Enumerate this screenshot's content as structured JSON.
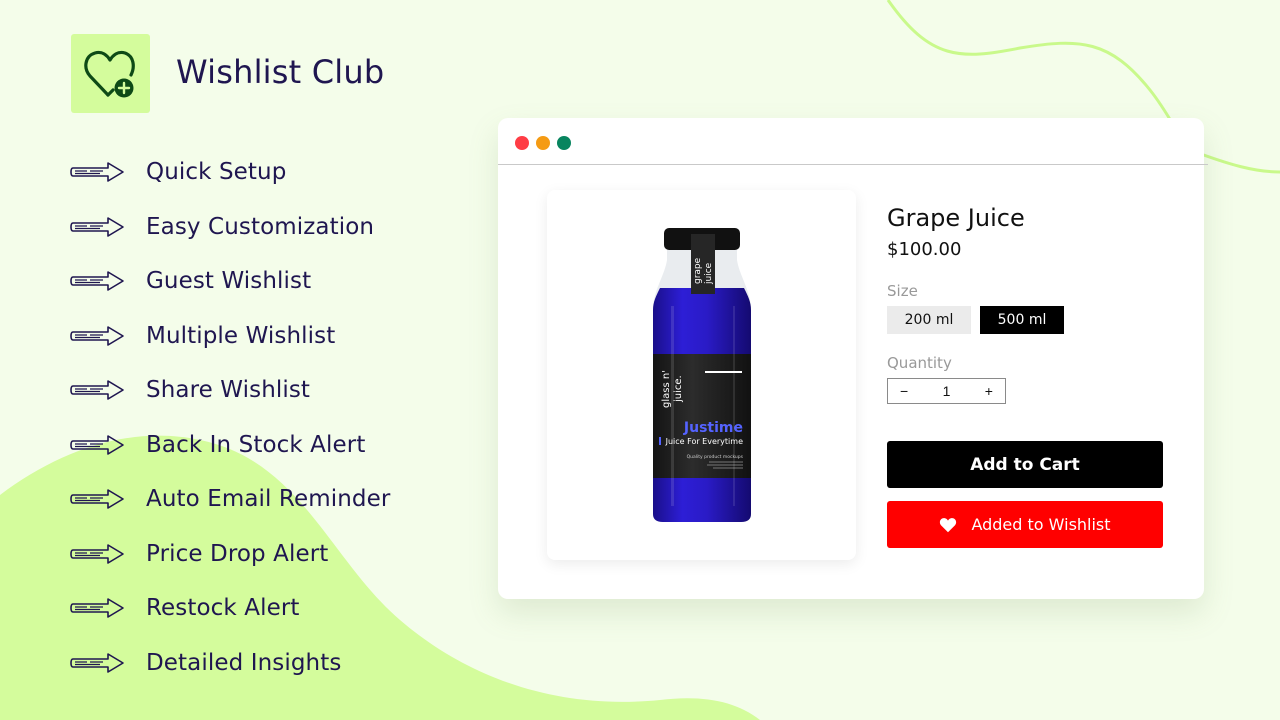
{
  "brand": {
    "name": "Wishlist Club",
    "logo_icon": "heart-plus-icon",
    "accent_color": "#d4fc9c",
    "text_color": "#1f1650"
  },
  "features": [
    {
      "label": "Quick Setup",
      "icon": "arrow-right-icon"
    },
    {
      "label": "Easy Customization",
      "icon": "arrow-right-icon"
    },
    {
      "label": "Guest Wishlist",
      "icon": "arrow-right-icon"
    },
    {
      "label": "Multiple Wishlist",
      "icon": "arrow-right-icon"
    },
    {
      "label": "Share Wishlist",
      "icon": "arrow-right-icon"
    },
    {
      "label": "Back In Stock Alert",
      "icon": "arrow-right-icon"
    },
    {
      "label": "Auto Email Reminder",
      "icon": "arrow-right-icon"
    },
    {
      "label": "Price Drop Alert",
      "icon": "arrow-right-icon"
    },
    {
      "label": "Restock Alert",
      "icon": "arrow-right-icon"
    },
    {
      "label": "Detailed Insights",
      "icon": "arrow-right-icon"
    }
  ],
  "browser": {
    "window_controls": [
      {
        "name": "close",
        "color": "#ff3d45"
      },
      {
        "name": "minimize",
        "color": "#f59b13"
      },
      {
        "name": "maximize",
        "color": "#08855f"
      }
    ]
  },
  "product": {
    "image": {
      "cap_label_line1": "grape",
      "cap_label_line2": "juice",
      "side_label_line1": "glass n'",
      "side_label_line2": "juice.",
      "brand": "Justime",
      "tagline": "Juice For Everytime",
      "fine_print": "Quality product mockups"
    },
    "title": "Grape Juice",
    "price": "$100.00",
    "size_label": "Size",
    "sizes": [
      {
        "label": "200 ml",
        "selected": false
      },
      {
        "label": "500 ml",
        "selected": true
      }
    ],
    "quantity_label": "Quantity",
    "quantity": {
      "decrement": "−",
      "value": "1",
      "increment": "+"
    },
    "add_to_cart_label": "Add to Cart",
    "wishlist_label": "Added to Wishlist",
    "wishlist_icon": "heart-filled-icon",
    "wishlist_color": "#ff0000"
  }
}
